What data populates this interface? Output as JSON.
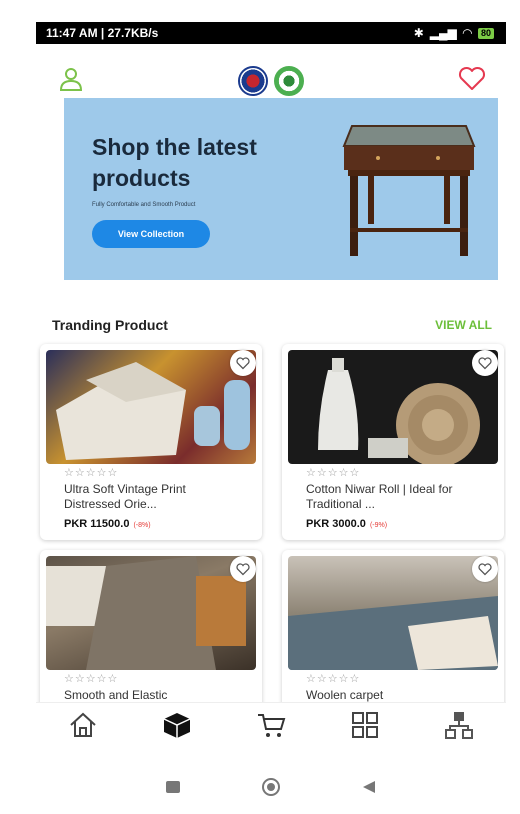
{
  "status_bar": {
    "time_speed": "11:47 AM | 27.7KB/s",
    "battery": "80"
  },
  "header": {
    "profile_icon": "user-icon",
    "wishlist_icon": "heart-icon"
  },
  "banner": {
    "title": "Shop the latest products",
    "subtitle": "Fully Comfortable and Smooth Product",
    "cta_label": "View Collection"
  },
  "trending": {
    "title": "Tranding Product",
    "view_all": "VIEW ALL"
  },
  "products": [
    {
      "stars": "☆☆☆☆☆",
      "name": "Ultra Soft Vintage Print Distressed Orie...",
      "price": "PKR 11500.0",
      "discount": "(-8%)"
    },
    {
      "stars": "☆☆☆☆☆",
      "name": "Cotton Niwar Roll | Ideal for Traditional ...",
      "price": "PKR 3000.0",
      "discount": "(-9%)"
    },
    {
      "stars": "☆☆☆☆☆",
      "name": "Smooth and Elastic",
      "price": "",
      "discount": ""
    },
    {
      "stars": "☆☆☆☆☆",
      "name": "Woolen carpet",
      "price": "",
      "discount": ""
    }
  ],
  "bottom_nav": [
    "home-icon",
    "package-icon",
    "cart-icon",
    "categories-icon",
    "profile-icon"
  ],
  "system_nav": [
    "recents-icon",
    "home-circle-icon",
    "back-icon"
  ],
  "colors": {
    "accent_green": "#6cbf3a",
    "cta_blue": "#1e88e5",
    "banner_bg": "#9ec9ea",
    "discount_red": "#e53935"
  }
}
